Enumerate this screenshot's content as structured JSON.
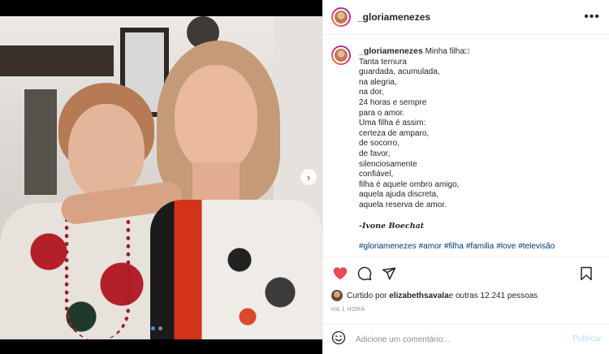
{
  "post": {
    "username": "_gloriamenezes",
    "more_label": "•••",
    "caption": {
      "username": "_gloriamenezes",
      "first_text": " Minha filha□",
      "lines": [
        "Tanta ternura",
        "guardada, acumulada,",
        "na alegria,",
        "na dor,",
        "24 horas e sempre",
        "para o amor.",
        "Uma filha é assim:",
        "certeza de amparo,",
        "de socorro,",
        "de favor,",
        "silenciosamente",
        "confiável,",
        "filha é aquele ombro amigo,",
        "aquela ajuda discreta,",
        "aquela reserva de amor."
      ],
      "author": "-Ivone Boechat",
      "hashtags": [
        "#gloriamenezes",
        "#amor",
        "#filha",
        "#familia",
        "#love",
        "#televisão"
      ]
    },
    "likes": {
      "prefix": "Curtido por ",
      "liker": "elizabethsavala",
      "suffix": " e outras 12.241 pessoas"
    },
    "time": "HÁ 1 HORA",
    "comment": {
      "placeholder": "Adicione um comentário...",
      "publish_label": "Publicar"
    }
  },
  "carousel": {
    "next_icon": "chevron-right-icon",
    "next_glyph": "›",
    "slide_count": 2,
    "active_slide": 1
  },
  "icons": {
    "like": "heart-icon",
    "comment": "comment-icon",
    "share": "share-icon",
    "save": "bookmark-icon",
    "emoji": "emoji-icon"
  },
  "colors": {
    "like_active": "#ed4956",
    "hashtag": "#00376b",
    "publish_disabled": "#b2dffc",
    "muted": "#8e8e8e"
  }
}
